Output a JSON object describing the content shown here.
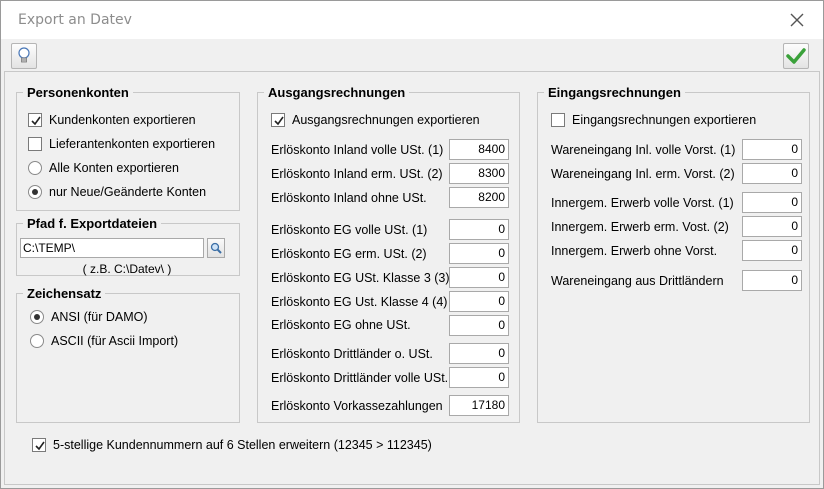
{
  "window": {
    "title": "Export an Datev"
  },
  "toolbar": {
    "help_icon": "lightbulb-icon",
    "ok_icon": "checkmark-icon"
  },
  "personenkonten": {
    "title": "Personenkonten",
    "kunden": {
      "label": "Kundenkonten exportieren",
      "checked": true
    },
    "lieferanten": {
      "label": "Lieferantenkonten exportieren",
      "checked": false
    },
    "alle": {
      "label": "Alle Konten exportieren",
      "selected": false
    },
    "neue": {
      "label": "nur Neue/Geänderte Konten",
      "selected": true
    }
  },
  "pfad": {
    "title": "Pfad f. Exportdateien",
    "value": "C:\\TEMP\\",
    "hint": "( z.B. C:\\Datev\\ )"
  },
  "zeichensatz": {
    "title": "Zeichensatz",
    "ansi": {
      "label": "ANSI (für DAMO)",
      "selected": true
    },
    "ascii": {
      "label": "ASCII (für Ascii Import)",
      "selected": false
    }
  },
  "ausgang": {
    "title": "Ausgangsrechnungen",
    "export": {
      "label": "Ausgangsrechnungen exportieren",
      "checked": true
    },
    "rows": [
      {
        "label": "Erlöskonto Inland volle USt. (1)",
        "value": "8400"
      },
      {
        "label": "Erlöskonto Inland erm. USt. (2)",
        "value": "8300"
      },
      {
        "label": "Erlöskonto Inland ohne USt.",
        "value": "8200"
      },
      {
        "label": "Erlöskonto EG volle USt. (1)",
        "value": "0"
      },
      {
        "label": "Erlöskonto EG erm. USt. (2)",
        "value": "0"
      },
      {
        "label": "Erlöskonto EG USt. Klasse 3 (3)",
        "value": "0"
      },
      {
        "label": "Erlöskonto EG Ust. Klasse 4 (4)",
        "value": "0"
      },
      {
        "label": "Erlöskonto EG ohne USt.",
        "value": "0"
      },
      {
        "label": "Erlöskonto Drittländer o. USt.",
        "value": "0"
      },
      {
        "label": "Erlöskonto Drittländer volle USt.",
        "value": "0"
      },
      {
        "label": "Erlöskonto Vorkassezahlungen",
        "value": "17180"
      }
    ]
  },
  "eingang": {
    "title": "Eingangsrechnungen",
    "export": {
      "label": "Eingangsrechnungen exportieren",
      "checked": false
    },
    "rows": [
      {
        "label": "Wareneingang Inl. volle Vorst. (1)",
        "value": "0"
      },
      {
        "label": "Wareneingang Inl. erm. Vorst. (2)",
        "value": "0"
      },
      {
        "label": "Innergem. Erwerb volle Vorst. (1)",
        "value": "0"
      },
      {
        "label": "Innergem. Erwerb erm. Vost. (2)",
        "value": "0"
      },
      {
        "label": "Innergem. Erwerb ohne Vorst.",
        "value": "0"
      },
      {
        "label": "Wareneingang aus Drittländern",
        "value": "0"
      }
    ]
  },
  "footer": {
    "kundennummern": {
      "label": "5-stellige Kundennummern  auf 6 Stellen erweitern (12345 > 112345)",
      "checked": true
    }
  }
}
